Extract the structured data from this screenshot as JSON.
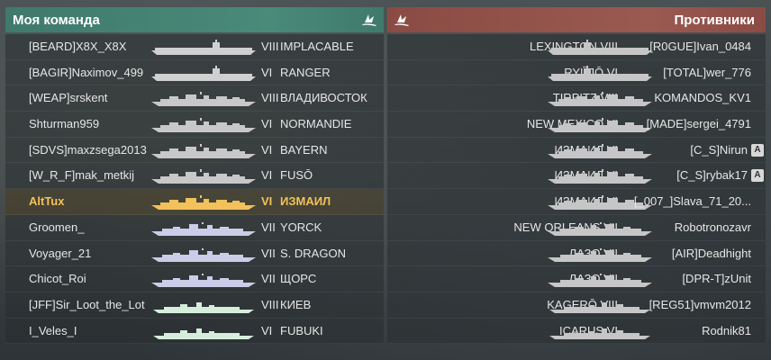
{
  "my_team": {
    "title": "Моя команда",
    "rows": [
      {
        "player": "[BEARD]X8X_X8X",
        "tier": "VIII",
        "ship": "IMPLACABLE",
        "type": "carrier"
      },
      {
        "player": "[BAGIR]Naximov_499",
        "tier": "VI",
        "ship": "RANGER",
        "type": "carrier"
      },
      {
        "player": "[WEAP]srskent",
        "tier": "VIII",
        "ship": "ВЛАДИВОСТОК",
        "type": "battleship"
      },
      {
        "player": "Shturman959",
        "tier": "VI",
        "ship": "NORMANDIE",
        "type": "battleship"
      },
      {
        "player": "[SDVS]maxzsega2013",
        "tier": "VI",
        "ship": "BAYERN",
        "type": "battleship"
      },
      {
        "player": "[W_R_F]mak_metkij",
        "tier": "VI",
        "ship": "FUSŌ",
        "type": "battleship"
      },
      {
        "player": "AltTux",
        "tier": "VI",
        "ship": "ИЗМАИЛ",
        "type": "battleship"
      },
      {
        "player": "Groomen_",
        "tier": "VII",
        "ship": "YORCK",
        "type": "cruiser"
      },
      {
        "player": "Voyager_21",
        "tier": "VII",
        "ship": "S. DRAGON",
        "type": "cruiser"
      },
      {
        "player": "Chicot_Roi",
        "tier": "VII",
        "ship": "ЩОРС",
        "type": "cruiser"
      },
      {
        "player": "[JFF]Sir_Loot_the_Lot",
        "tier": "VIII",
        "ship": "КИЕВ",
        "type": "destroyer"
      },
      {
        "player": "I_Veles_I",
        "tier": "VI",
        "ship": "FUBUKI",
        "type": "destroyer"
      }
    ]
  },
  "enemies": {
    "title": "Противники",
    "rows": [
      {
        "player": "[R0GUE]Ivan_0484",
        "tier": "VIII",
        "ship": "LEXINGTON",
        "type": "carrier"
      },
      {
        "player": "[TOTAL]wer_776",
        "tier": "VI",
        "ship": "RYŪJŌ",
        "type": "carrier"
      },
      {
        "player": "KOMANDOS_KV1",
        "tier": "VIII",
        "ship": "TIRPITZ",
        "type": "battleship"
      },
      {
        "player": "[MADE]sergei_4791",
        "tier": "VI",
        "ship": "NEW MEXICO",
        "type": "battleship"
      },
      {
        "player": "[C_S]Nirun",
        "tier": "VI",
        "ship": "ИЗМАИЛ",
        "type": "battleship",
        "badge": "A"
      },
      {
        "player": "[C_S]rybak17",
        "tier": "VI",
        "ship": "ИЗМАИЛ",
        "type": "battleship",
        "badge": "A"
      },
      {
        "player": "[_007_]Slava_71_20...",
        "tier": "VI",
        "ship": "ИЗМАИЛ",
        "type": "battleship"
      },
      {
        "player": "Robotronozavr",
        "tier": "VII",
        "ship": "NEW ORLEANS",
        "type": "cruiser"
      },
      {
        "player": "[AIR]Deadhight",
        "tier": "VII",
        "ship": "ЛАЗО",
        "type": "cruiser"
      },
      {
        "player": "[DPR-T]zUnit",
        "tier": "VII",
        "ship": "ЛАЗО",
        "type": "cruiser"
      },
      {
        "player": "[REG51]vmvm2012",
        "tier": "VIII",
        "ship": "KAGERŌ",
        "type": "destroyer"
      },
      {
        "player": "Rodnik81",
        "tier": "VI",
        "ship": "ICARUS",
        "type": "destroyer"
      }
    ]
  },
  "colors": {
    "ally_header": "#4a8a79",
    "enemy_header": "#9a5a51",
    "self_highlight": "#f2c15b",
    "carrier": "#d0d0d0",
    "battleship": "#c8c8c8",
    "cruiser": "#c9cde8",
    "destroyer": "#d6eddc",
    "enemy_ship": "#c6c6c6"
  }
}
